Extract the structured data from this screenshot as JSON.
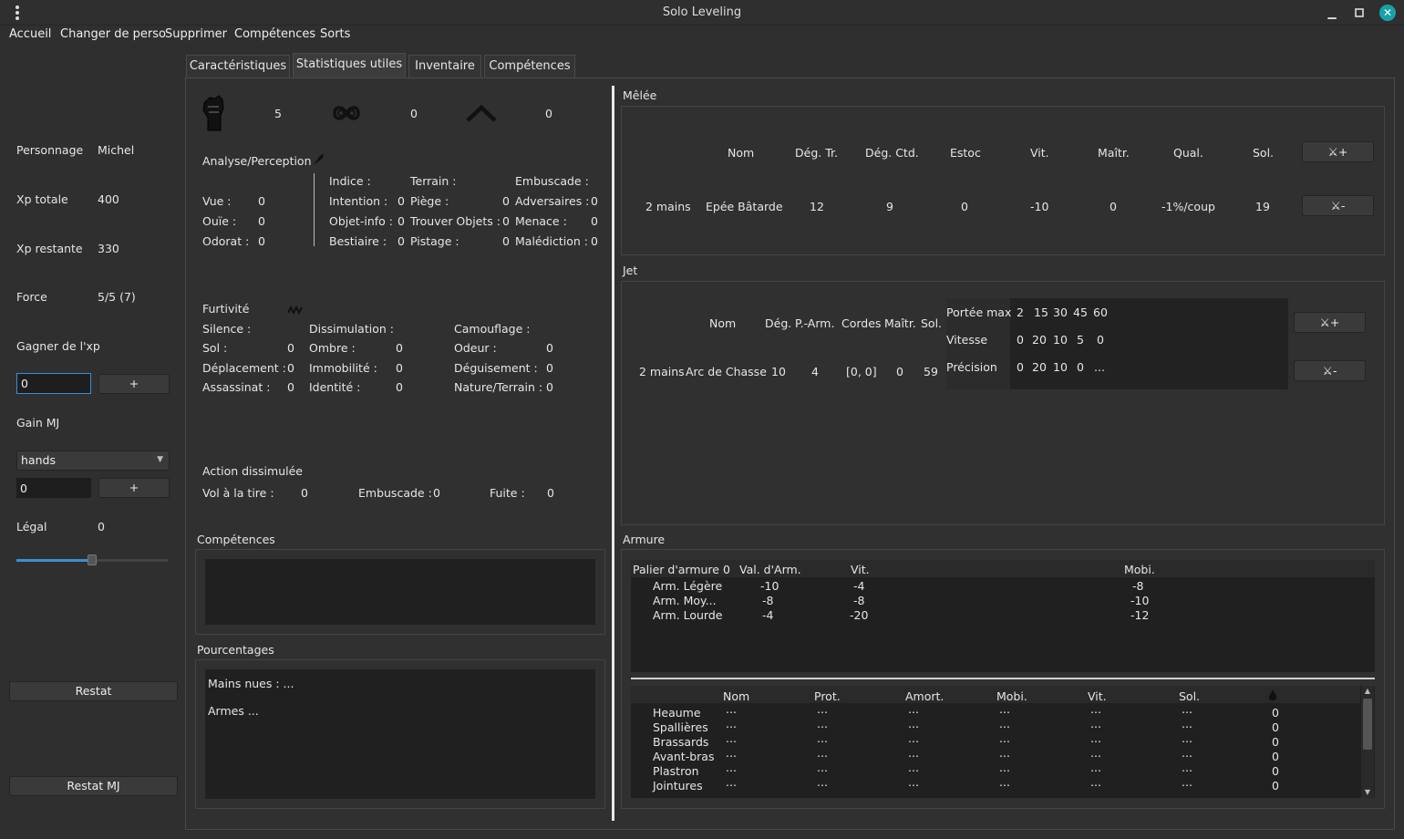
{
  "window": {
    "title": "Solo Leveling"
  },
  "menu": {
    "items": [
      "Accueil",
      "Changer de perso",
      "Supprimer",
      "Compétences",
      "Sorts"
    ]
  },
  "sidebar": {
    "personnage_label": "Personnage",
    "personnage_value": "Michel",
    "xp_totale_label": "Xp totale",
    "xp_totale_value": "400",
    "xp_restante_label": "Xp restante",
    "xp_restante_value": "330",
    "force_label": "Force",
    "force_value": "5/5 (7)",
    "gagner_xp_label": "Gagner de l'xp",
    "gagner_xp_input": "0",
    "plus": "+",
    "gain_mj_label": "Gain MJ",
    "gain_mj_select": "hands",
    "gain_mj_input": "0",
    "legal_label": "Légal",
    "legal_value": "0",
    "legal_slider": 0.5,
    "restat": "Restat",
    "restat_mj": "Restat MJ"
  },
  "tabs": [
    "Caractéristiques",
    "Statistiques utiles",
    "Inventaire",
    "Compétences"
  ],
  "stats": {
    "icon_values": [
      "5",
      "0",
      "0"
    ]
  },
  "analyse": {
    "title": "Analyse/Perception",
    "left": [
      [
        "Vue :",
        "0"
      ],
      [
        "Ouïe :",
        "0"
      ],
      [
        "Odorat :",
        "0"
      ]
    ],
    "col_headers": [
      "Indice :",
      "Terrain :",
      "Embuscade :"
    ],
    "col1": [
      [
        "Intention :",
        "0"
      ],
      [
        "Objet-info :",
        "0"
      ],
      [
        "Bestiaire :",
        "0"
      ]
    ],
    "col2": [
      [
        "Piège :",
        "0"
      ],
      [
        "Trouver Objets :",
        "0"
      ],
      [
        "Pistage :",
        "0"
      ]
    ],
    "col3": [
      [
        "Adversaires :",
        "0"
      ],
      [
        "Menace :",
        "0"
      ],
      [
        "Malédiction :",
        "0"
      ]
    ]
  },
  "furtivite": {
    "title": "Furtivité",
    "headers": [
      "Silence :",
      "Dissimulation :",
      "Camouflage :"
    ],
    "col1": [
      [
        "Sol :",
        "0"
      ],
      [
        "Déplacement :",
        "0"
      ],
      [
        "Assassinat :",
        "0"
      ]
    ],
    "col2": [
      [
        "Ombre :",
        "0"
      ],
      [
        "Immobilité :",
        "0"
      ],
      [
        "Identité :",
        "0"
      ]
    ],
    "col3": [
      [
        "Odeur :",
        "0"
      ],
      [
        "Déguisement :",
        "0"
      ],
      [
        "Nature/Terrain :",
        "0"
      ]
    ]
  },
  "action": {
    "title": "Action dissimulée",
    "items": [
      [
        "Vol à la tire :",
        "0"
      ],
      [
        "Embuscade :",
        "0"
      ],
      [
        "Fuite :",
        "0"
      ]
    ]
  },
  "competences": {
    "title": "Compétences"
  },
  "pourcentages": {
    "title": "Pourcentages",
    "lines": [
      "Mains nues : ...",
      "Armes ..."
    ]
  },
  "melee": {
    "title": "Mêlée",
    "headers": [
      "Nom",
      "Dég. Tr.",
      "Dég. Ctd.",
      "Estoc",
      "Vit.",
      "Maîtr.",
      "Qual.",
      "Sol."
    ],
    "row": [
      "2 mains",
      "Epée Bâtarde",
      "12",
      "9",
      "0",
      "-10",
      "0",
      "-1%/coup",
      "19"
    ],
    "add": "+",
    "remove": "-"
  },
  "jet": {
    "title": "Jet",
    "headers": [
      "Nom",
      "Dég.",
      "P.-Arm.",
      "Cordes",
      "Maîtr.",
      "Sol."
    ],
    "row": [
      "2 mains",
      "Arc de Chasse",
      "10",
      "4",
      "[0, 0]",
      "0",
      "59"
    ],
    "ranges": [
      {
        "label": "Portée max",
        "values": [
          "2",
          "15",
          "30",
          "45",
          "60"
        ]
      },
      {
        "label": "Vitesse",
        "values": [
          "0",
          "20",
          "10",
          "5",
          "0"
        ]
      },
      {
        "label": "Précision",
        "values": [
          "0",
          "20",
          "10",
          "0",
          "..."
        ]
      }
    ],
    "add": "+",
    "remove": "-"
  },
  "armure": {
    "title": "Armure",
    "headers": [
      "Palier d'armure 0",
      "Val. d'Arm.",
      "Vit.",
      "Mobi."
    ],
    "rows": [
      [
        "Arm. Légère",
        "-10",
        "-4",
        "-8"
      ],
      [
        "Arm. Moy...",
        "-8",
        "-8",
        "-10"
      ],
      [
        "Arm. Lourde",
        "-4",
        "-20",
        "-12"
      ]
    ],
    "pieces_headers": [
      "Nom",
      "Prot.",
      "Amort.",
      "Mobi.",
      "Vit.",
      "Sol."
    ],
    "pieces": [
      {
        "name": "Heaume",
        "cells": [
          "...",
          "...",
          "...",
          "...",
          "...",
          "..."
        ],
        "last": "0"
      },
      {
        "name": "Spallières",
        "cells": [
          "...",
          "...",
          "...",
          "...",
          "...",
          "..."
        ],
        "last": "0"
      },
      {
        "name": "Brassards",
        "cells": [
          "...",
          "...",
          "...",
          "...",
          "...",
          "..."
        ],
        "last": "0"
      },
      {
        "name": "Avant-bras",
        "cells": [
          "...",
          "...",
          "...",
          "...",
          "...",
          "..."
        ],
        "last": "0"
      },
      {
        "name": "Plastron",
        "cells": [
          "...",
          "...",
          "...",
          "...",
          "...",
          "..."
        ],
        "last": "0"
      },
      {
        "name": "Jointures",
        "cells": [
          "...",
          "...",
          "...",
          "...",
          "...",
          "..."
        ],
        "last": "0"
      }
    ]
  }
}
